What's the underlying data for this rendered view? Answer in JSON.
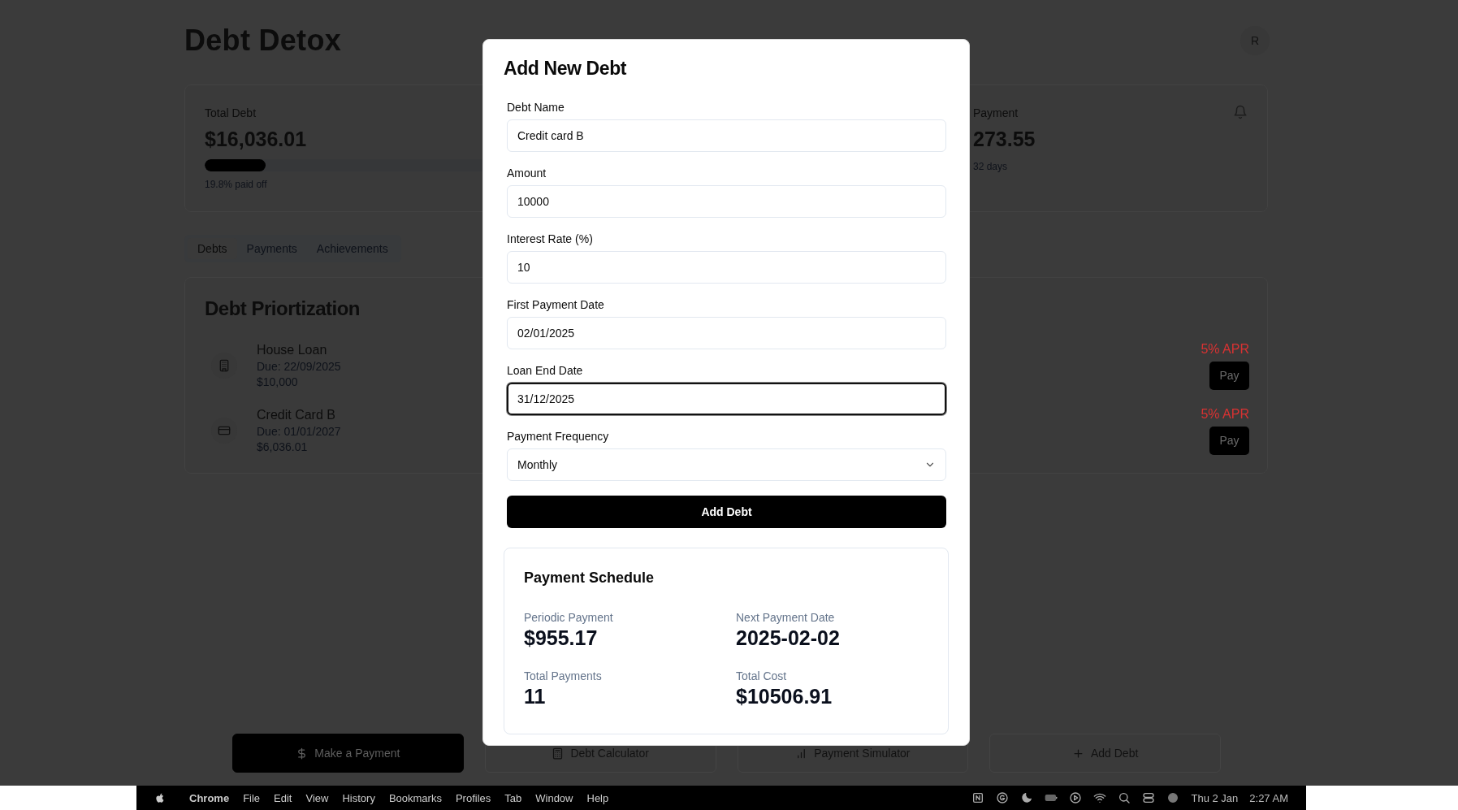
{
  "app": {
    "title": "Debt Detox",
    "avatar": "R"
  },
  "summary": {
    "total_label": "Total Debt",
    "total_value": "$16,036.01",
    "paid_progress": {
      "level": 0.198
    },
    "paid_text": "19.8% paid off",
    "next_label": "Payment",
    "next_value": "273.55",
    "next_note": "32 days"
  },
  "tabs": [
    {
      "label": "Debts",
      "selected": true
    },
    {
      "label": "Payments",
      "selected": false
    },
    {
      "label": "Achievements",
      "selected": false
    }
  ],
  "priority": {
    "title": "Debt Priortization",
    "debts": [
      {
        "kind": "building",
        "name": "House Loan",
        "due": "Due: 22/09/2025",
        "amount": "$10,000",
        "apr": "5% APR",
        "action": "Pay"
      },
      {
        "kind": "card",
        "name": "Credit Card B",
        "due": "Due: 01/01/2027",
        "amount": "$6,036.01",
        "apr": "5% APR",
        "action": "Pay"
      }
    ]
  },
  "actions": [
    {
      "kind": "dollar",
      "label": "Make a Payment",
      "primary": true
    },
    {
      "kind": "calculator",
      "label": "Debt Calculator",
      "primary": false
    },
    {
      "kind": "chart",
      "label": "Payment Simulator",
      "primary": false
    },
    {
      "kind": "plus",
      "label": "Add Debt",
      "primary": false
    }
  ],
  "dialog": {
    "title": "Add New Debt",
    "fields": [
      {
        "kind": "text",
        "label": "Debt Name",
        "value": "Credit card B",
        "focused": false
      },
      {
        "kind": "text",
        "label": "Amount",
        "value": "10000",
        "focused": false
      },
      {
        "kind": "text",
        "label": "Interest Rate (%)",
        "value": "10",
        "focused": false
      },
      {
        "kind": "text",
        "label": "First Payment Date",
        "value": "02/01/2025",
        "focused": false
      },
      {
        "kind": "text",
        "label": "Loan End Date",
        "value": "31/12/2025",
        "focused": true
      },
      {
        "kind": "select",
        "label": "Payment Frequency",
        "value": "Monthly",
        "focused": false
      }
    ],
    "submit": "Add Debt",
    "schedule": {
      "title": "Payment Schedule",
      "stats": [
        {
          "label": "Periodic Payment",
          "value": "$955.17"
        },
        {
          "label": "Next Payment Date",
          "value": "2025-02-02"
        },
        {
          "label": "Total Payments",
          "value": "11"
        },
        {
          "label": "Total Cost",
          "value": "$10506.91"
        }
      ]
    }
  },
  "menubar": {
    "app": "Chrome",
    "menus": [
      "File",
      "Edit",
      "View",
      "History",
      "Bookmarks",
      "Profiles",
      "Tab",
      "Window",
      "Help"
    ],
    "date": "Thu 2 Jan",
    "time": "2:27 AM"
  }
}
